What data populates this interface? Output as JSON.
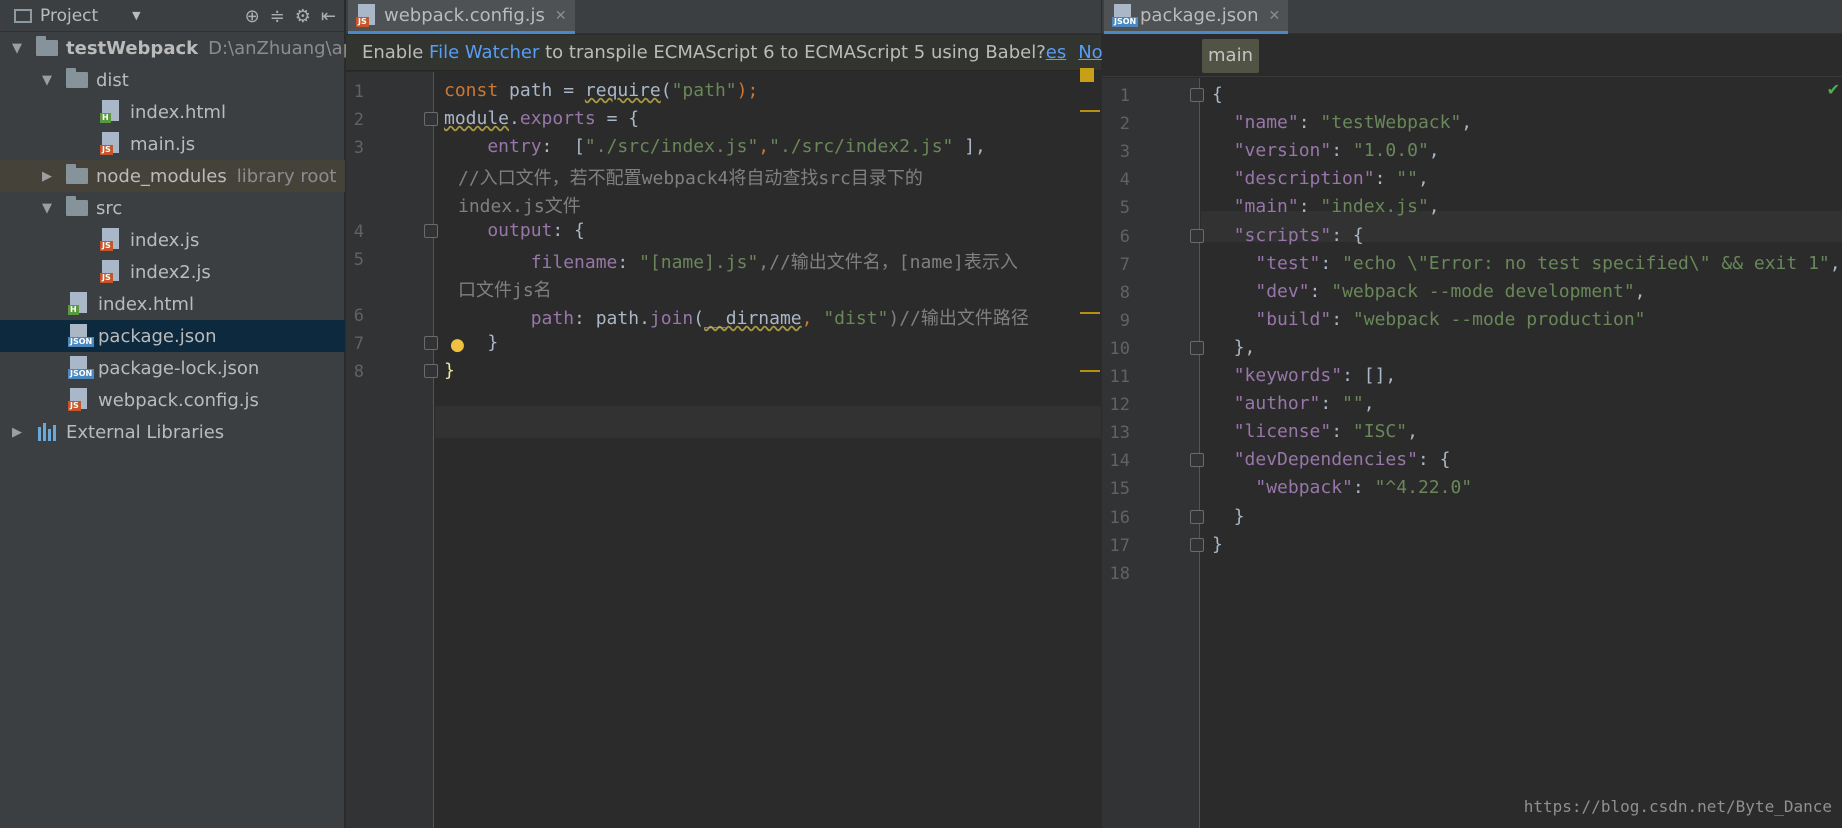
{
  "project": {
    "header_title": "Project",
    "tree": [
      {
        "label": "testWebpack",
        "suffix": "D:\\anZhuang\\app",
        "kind": "root"
      },
      {
        "label": "dist",
        "kind": "folder"
      },
      {
        "label": "index.html",
        "kind": "html"
      },
      {
        "label": "main.js",
        "kind": "js"
      },
      {
        "label": "node_modules",
        "suffix": "library root",
        "kind": "folder"
      },
      {
        "label": "src",
        "kind": "folder"
      },
      {
        "label": "index.js",
        "kind": "js"
      },
      {
        "label": "index2.js",
        "kind": "js"
      },
      {
        "label": "index.html",
        "kind": "html"
      },
      {
        "label": "package.json",
        "kind": "json"
      },
      {
        "label": "package-lock.json",
        "kind": "json"
      },
      {
        "label": "webpack.config.js",
        "kind": "js"
      },
      {
        "label": "External Libraries",
        "kind": "lib"
      }
    ]
  },
  "left_editor": {
    "tab_label": "webpack.config.js",
    "notice": {
      "prefix": "Enable ",
      "link": "File Watcher",
      "text": " to transpile ECMAScript 6 to ECMAScript 5 using Babel?",
      "yes": "es",
      "no": "No"
    },
    "line_numbers": [
      "1",
      "2",
      "3",
      "4",
      "5",
      "6",
      "7",
      "8"
    ],
    "code": {
      "l1_kw": "const",
      "l1_rest": " path = ",
      "l1_fn": "require",
      "l1_open": "(",
      "l1_str": "\"path\"",
      "l1_close": ");",
      "l2_a": "module",
      "l2_b": ".",
      "l2_c": "exports",
      "l2_d": " = {",
      "l3_a": "    entry",
      "l3_b": ":  [",
      "l3_c": "\"./src/index.js\"",
      "l3_d": ",",
      "l3_e": "\"./src/index2.js\"",
      "l3_f": " ],",
      "l3_cmt1": "//入口文件，若不配置webpack4将自动查找src目录下的",
      "l3_cmt2": "index.js文件",
      "l4_a": "    output",
      "l4_b": ": {",
      "l5_a": "        filename",
      "l5_b": ": ",
      "l5_c": "\"[name].js\"",
      "l5_d": ",//输出文件名，[name]表示入",
      "l5_cmt2": "口文件js名",
      "l6_a": "        path",
      "l6_b": ": path.",
      "l6_c": "join",
      "l6_d": "(",
      "l6_e": "__dirname",
      "l6_f": ", ",
      "l6_g": "\"dist\"",
      "l6_h": ")//输出文件路径",
      "l7": "    }",
      "l8": "}"
    }
  },
  "right_editor": {
    "tab_label": "package.json",
    "breadcrumb": "main",
    "line_numbers": [
      "1",
      "2",
      "3",
      "4",
      "5",
      "6",
      "7",
      "8",
      "9",
      "10",
      "11",
      "12",
      "13",
      "14",
      "15",
      "16",
      "17",
      "18"
    ],
    "lines": [
      {
        "indent": "",
        "key": "",
        "val": "",
        "plain": "{"
      },
      {
        "indent": "  ",
        "key": "\"name\"",
        "sep": ": ",
        "val": "\"testWebpack\"",
        "tail": ","
      },
      {
        "indent": "  ",
        "key": "\"version\"",
        "sep": ": ",
        "val": "\"1.0.0\"",
        "tail": ","
      },
      {
        "indent": "  ",
        "key": "\"description\"",
        "sep": ": ",
        "val": "\"\"",
        "tail": ","
      },
      {
        "indent": "  ",
        "key": "\"main\"",
        "sep": ": ",
        "val": "\"index.js\"",
        "tail": ","
      },
      {
        "indent": "  ",
        "key": "\"scripts\"",
        "sep": ": {",
        "val": "",
        "tail": ""
      },
      {
        "indent": "    ",
        "key": "\"test\"",
        "sep": ": ",
        "val": "\"echo \\\"Error: no test specified\\\" && exit 1\"",
        "tail": ","
      },
      {
        "indent": "    ",
        "key": "\"dev\"",
        "sep": ": ",
        "val": "\"webpack --mode development\"",
        "tail": ","
      },
      {
        "indent": "    ",
        "key": "\"build\"",
        "sep": ": ",
        "val": "\"webpack --mode production\"",
        "tail": ""
      },
      {
        "indent": "  ",
        "key": "",
        "val": "",
        "plain": "},"
      },
      {
        "indent": "  ",
        "key": "\"keywords\"",
        "sep": ": [],",
        "val": "",
        "tail": ""
      },
      {
        "indent": "  ",
        "key": "\"author\"",
        "sep": ": ",
        "val": "\"\"",
        "tail": ","
      },
      {
        "indent": "  ",
        "key": "\"license\"",
        "sep": ": ",
        "val": "\"ISC\"",
        "tail": ","
      },
      {
        "indent": "  ",
        "key": "\"devDependencies\"",
        "sep": ": {",
        "val": "",
        "tail": ""
      },
      {
        "indent": "    ",
        "key": "\"webpack\"",
        "sep": ": ",
        "val": "\"^4.22.0\"",
        "tail": ""
      },
      {
        "indent": "  ",
        "key": "",
        "val": "",
        "plain": "}"
      },
      {
        "indent": "",
        "key": "",
        "val": "",
        "plain": "}"
      },
      {
        "indent": "",
        "key": "",
        "val": "",
        "plain": ""
      }
    ],
    "watermark": "https://blog.csdn.net/Byte_Dance"
  }
}
